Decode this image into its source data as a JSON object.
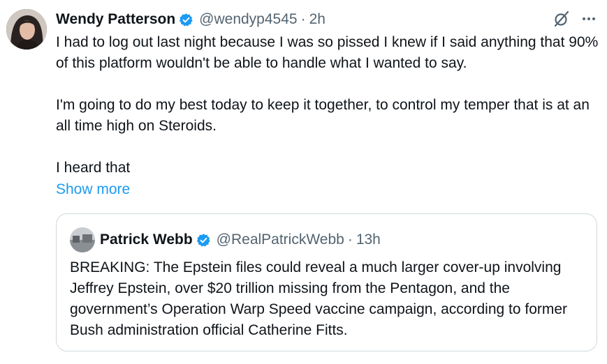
{
  "tweet": {
    "author_name": "Wendy Patterson",
    "handle": "@wendyp4545",
    "separator": "·",
    "time": "2h",
    "paragraphs": [
      "I had to log out last night because I was so pissed I knew if I said anything that 90% of this platform wouldn't be able to handle what I wanted to say.",
      "I'm going to do my best today to keep it together, to control my temper that is at an all time high on Steroids.",
      "I heard that"
    ],
    "show_more": "Show more",
    "icons": {
      "verified": "verified-badge-icon",
      "slash": "grok-slash-icon",
      "more": "more-icon"
    },
    "colors": {
      "verified": "#1d9bf0",
      "link": "#1d9bf0",
      "muted": "#536471",
      "border": "#cfd9de"
    }
  },
  "quote": {
    "author_name": "Patrick Webb",
    "handle": "@RealPatrickWebb",
    "separator": "·",
    "time": "13h",
    "text": "BREAKING: The Epstein files could reveal a much larger cover-up involving Jeffrey Epstein, over $20 trillion missing from the Pentagon, and the government’s Operation Warp Speed vaccine campaign, according to former Bush administration official Catherine Fitts."
  }
}
